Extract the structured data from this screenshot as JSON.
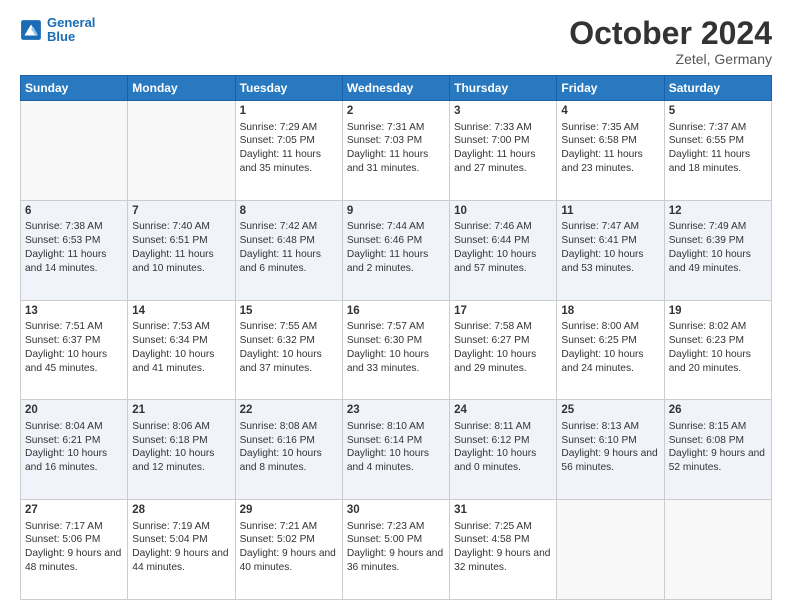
{
  "header": {
    "logo_line1": "General",
    "logo_line2": "Blue",
    "month_title": "October 2024",
    "location": "Zetel, Germany"
  },
  "weekdays": [
    "Sunday",
    "Monday",
    "Tuesday",
    "Wednesday",
    "Thursday",
    "Friday",
    "Saturday"
  ],
  "rows": [
    [
      {
        "day": "",
        "sunrise": "",
        "sunset": "",
        "daylight": ""
      },
      {
        "day": "",
        "sunrise": "",
        "sunset": "",
        "daylight": ""
      },
      {
        "day": "1",
        "sunrise": "Sunrise: 7:29 AM",
        "sunset": "Sunset: 7:05 PM",
        "daylight": "Daylight: 11 hours and 35 minutes."
      },
      {
        "day": "2",
        "sunrise": "Sunrise: 7:31 AM",
        "sunset": "Sunset: 7:03 PM",
        "daylight": "Daylight: 11 hours and 31 minutes."
      },
      {
        "day": "3",
        "sunrise": "Sunrise: 7:33 AM",
        "sunset": "Sunset: 7:00 PM",
        "daylight": "Daylight: 11 hours and 27 minutes."
      },
      {
        "day": "4",
        "sunrise": "Sunrise: 7:35 AM",
        "sunset": "Sunset: 6:58 PM",
        "daylight": "Daylight: 11 hours and 23 minutes."
      },
      {
        "day": "5",
        "sunrise": "Sunrise: 7:37 AM",
        "sunset": "Sunset: 6:55 PM",
        "daylight": "Daylight: 11 hours and 18 minutes."
      }
    ],
    [
      {
        "day": "6",
        "sunrise": "Sunrise: 7:38 AM",
        "sunset": "Sunset: 6:53 PM",
        "daylight": "Daylight: 11 hours and 14 minutes."
      },
      {
        "day": "7",
        "sunrise": "Sunrise: 7:40 AM",
        "sunset": "Sunset: 6:51 PM",
        "daylight": "Daylight: 11 hours and 10 minutes."
      },
      {
        "day": "8",
        "sunrise": "Sunrise: 7:42 AM",
        "sunset": "Sunset: 6:48 PM",
        "daylight": "Daylight: 11 hours and 6 minutes."
      },
      {
        "day": "9",
        "sunrise": "Sunrise: 7:44 AM",
        "sunset": "Sunset: 6:46 PM",
        "daylight": "Daylight: 11 hours and 2 minutes."
      },
      {
        "day": "10",
        "sunrise": "Sunrise: 7:46 AM",
        "sunset": "Sunset: 6:44 PM",
        "daylight": "Daylight: 10 hours and 57 minutes."
      },
      {
        "day": "11",
        "sunrise": "Sunrise: 7:47 AM",
        "sunset": "Sunset: 6:41 PM",
        "daylight": "Daylight: 10 hours and 53 minutes."
      },
      {
        "day": "12",
        "sunrise": "Sunrise: 7:49 AM",
        "sunset": "Sunset: 6:39 PM",
        "daylight": "Daylight: 10 hours and 49 minutes."
      }
    ],
    [
      {
        "day": "13",
        "sunrise": "Sunrise: 7:51 AM",
        "sunset": "Sunset: 6:37 PM",
        "daylight": "Daylight: 10 hours and 45 minutes."
      },
      {
        "day": "14",
        "sunrise": "Sunrise: 7:53 AM",
        "sunset": "Sunset: 6:34 PM",
        "daylight": "Daylight: 10 hours and 41 minutes."
      },
      {
        "day": "15",
        "sunrise": "Sunrise: 7:55 AM",
        "sunset": "Sunset: 6:32 PM",
        "daylight": "Daylight: 10 hours and 37 minutes."
      },
      {
        "day": "16",
        "sunrise": "Sunrise: 7:57 AM",
        "sunset": "Sunset: 6:30 PM",
        "daylight": "Daylight: 10 hours and 33 minutes."
      },
      {
        "day": "17",
        "sunrise": "Sunrise: 7:58 AM",
        "sunset": "Sunset: 6:27 PM",
        "daylight": "Daylight: 10 hours and 29 minutes."
      },
      {
        "day": "18",
        "sunrise": "Sunrise: 8:00 AM",
        "sunset": "Sunset: 6:25 PM",
        "daylight": "Daylight: 10 hours and 24 minutes."
      },
      {
        "day": "19",
        "sunrise": "Sunrise: 8:02 AM",
        "sunset": "Sunset: 6:23 PM",
        "daylight": "Daylight: 10 hours and 20 minutes."
      }
    ],
    [
      {
        "day": "20",
        "sunrise": "Sunrise: 8:04 AM",
        "sunset": "Sunset: 6:21 PM",
        "daylight": "Daylight: 10 hours and 16 minutes."
      },
      {
        "day": "21",
        "sunrise": "Sunrise: 8:06 AM",
        "sunset": "Sunset: 6:18 PM",
        "daylight": "Daylight: 10 hours and 12 minutes."
      },
      {
        "day": "22",
        "sunrise": "Sunrise: 8:08 AM",
        "sunset": "Sunset: 6:16 PM",
        "daylight": "Daylight: 10 hours and 8 minutes."
      },
      {
        "day": "23",
        "sunrise": "Sunrise: 8:10 AM",
        "sunset": "Sunset: 6:14 PM",
        "daylight": "Daylight: 10 hours and 4 minutes."
      },
      {
        "day": "24",
        "sunrise": "Sunrise: 8:11 AM",
        "sunset": "Sunset: 6:12 PM",
        "daylight": "Daylight: 10 hours and 0 minutes."
      },
      {
        "day": "25",
        "sunrise": "Sunrise: 8:13 AM",
        "sunset": "Sunset: 6:10 PM",
        "daylight": "Daylight: 9 hours and 56 minutes."
      },
      {
        "day": "26",
        "sunrise": "Sunrise: 8:15 AM",
        "sunset": "Sunset: 6:08 PM",
        "daylight": "Daylight: 9 hours and 52 minutes."
      }
    ],
    [
      {
        "day": "27",
        "sunrise": "Sunrise: 7:17 AM",
        "sunset": "Sunset: 5:06 PM",
        "daylight": "Daylight: 9 hours and 48 minutes."
      },
      {
        "day": "28",
        "sunrise": "Sunrise: 7:19 AM",
        "sunset": "Sunset: 5:04 PM",
        "daylight": "Daylight: 9 hours and 44 minutes."
      },
      {
        "day": "29",
        "sunrise": "Sunrise: 7:21 AM",
        "sunset": "Sunset: 5:02 PM",
        "daylight": "Daylight: 9 hours and 40 minutes."
      },
      {
        "day": "30",
        "sunrise": "Sunrise: 7:23 AM",
        "sunset": "Sunset: 5:00 PM",
        "daylight": "Daylight: 9 hours and 36 minutes."
      },
      {
        "day": "31",
        "sunrise": "Sunrise: 7:25 AM",
        "sunset": "Sunset: 4:58 PM",
        "daylight": "Daylight: 9 hours and 32 minutes."
      },
      {
        "day": "",
        "sunrise": "",
        "sunset": "",
        "daylight": ""
      },
      {
        "day": "",
        "sunrise": "",
        "sunset": "",
        "daylight": ""
      }
    ]
  ]
}
